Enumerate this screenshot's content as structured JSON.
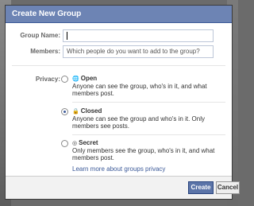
{
  "dialog": {
    "title": "Create New Group",
    "group_name_label": "Group Name:",
    "group_name_value": "",
    "members_label": "Members:",
    "members_placeholder": "Which people do you want to add to the group?",
    "privacy_label": "Privacy:",
    "privacy_options": [
      {
        "title": "Open",
        "icon": "globe-icon",
        "description": "Anyone can see the group, who's in it, and what members post.",
        "selected": false
      },
      {
        "title": "Closed",
        "icon": "lock-icon",
        "description": "Anyone can see the group and who's in it. Only members see posts.",
        "selected": true
      },
      {
        "title": "Secret",
        "icon": "secret-icon",
        "description": "Only members see the group, who's in it, and what members post.",
        "selected": false
      }
    ],
    "privacy_link": "Learn more about groups privacy",
    "create_label": "Create",
    "cancel_label": "Cancel"
  }
}
